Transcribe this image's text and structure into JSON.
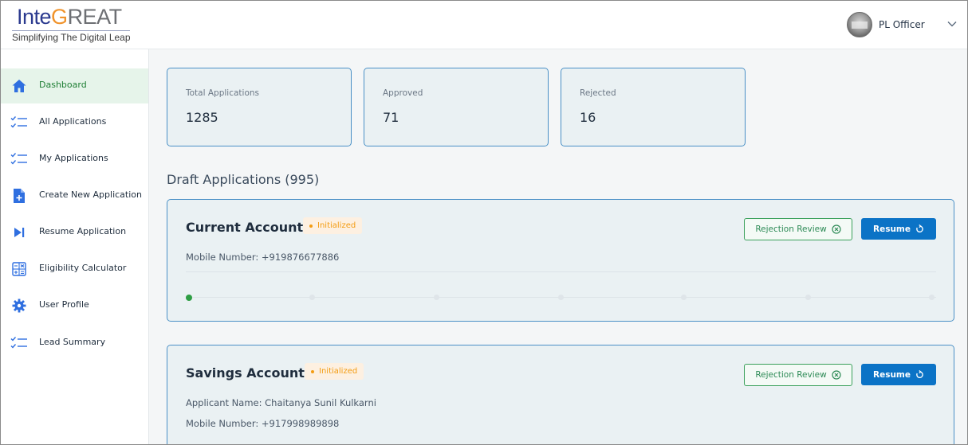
{
  "brand": {
    "logo_part_a": "Inte",
    "logo_part_g": "G",
    "logo_part_b": "REAT",
    "tagline": "Simplifying The Digital Leap"
  },
  "user": {
    "name": "PL Officer"
  },
  "sidebar": {
    "items": [
      {
        "label": "Dashboard",
        "icon": "home-icon",
        "active": true
      },
      {
        "label": "All Applications",
        "icon": "checklist-icon"
      },
      {
        "label": "My Applications",
        "icon": "checklist-icon"
      },
      {
        "label": "Create New Application",
        "icon": "file-plus-icon"
      },
      {
        "label": "Resume Application",
        "icon": "play-next-icon"
      },
      {
        "label": "Eligibility Calculator",
        "icon": "calculator-icon"
      },
      {
        "label": "User Profile",
        "icon": "gear-icon"
      },
      {
        "label": "Lead Summary",
        "icon": "checklist-icon"
      }
    ]
  },
  "stats": [
    {
      "label": "Total Applications",
      "value": "1285"
    },
    {
      "label": "Approved",
      "value": "71"
    },
    {
      "label": "Rejected",
      "value": "16"
    }
  ],
  "drafts": {
    "title": "Draft Applications (995)",
    "cards": [
      {
        "title": "Current Account",
        "status": "Initialized",
        "lines": [
          "Mobile Number: +919876677886"
        ],
        "review_label": "Rejection Review",
        "resume_label": "Resume",
        "steps_total": 7,
        "steps_done": 1
      },
      {
        "title": "Savings Account",
        "status": "Initialized",
        "lines": [
          "Applicant Name: Chaitanya Sunil Kulkarni",
          "Mobile Number: +917998989898"
        ],
        "review_label": "Rejection Review",
        "resume_label": "Resume"
      }
    ]
  },
  "colors": {
    "accent": "#0b73c6",
    "active_nav_bg": "#e6f4ea",
    "active_nav_text": "#1e7e34",
    "card_border": "#4a90c6",
    "status_initialized": "#f39c12",
    "review_green": "#3aa05a"
  }
}
